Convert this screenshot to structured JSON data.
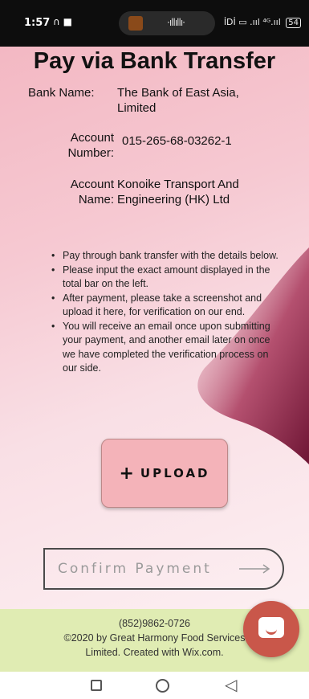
{
  "status_bar": {
    "time": "1:57",
    "left_icons": "∩ ■",
    "right_icons": "İDİ ▭ .ııl ⁴ᴳ.ııl",
    "battery": "54"
  },
  "page": {
    "title": "Pay via Bank Transfer",
    "bank_name_label": "Bank Name:",
    "bank_name_value": [
      "The Bank of East Asia,",
      "Limited"
    ],
    "account_number_label": [
      "Account",
      "Number:"
    ],
    "account_number_value": "015-265-68-03262-1",
    "account_name_label": [
      "Account",
      "Name:"
    ],
    "account_name_value": [
      "Konoike Transport And",
      "Engineering (HK) Ltd"
    ],
    "instructions": [
      "Pay through bank transfer with the details below.",
      "Please input the exact amount displayed in the total bar on the left.",
      "After payment, please take a screenshot and upload it here, for verification on our end.",
      "You will receive an email once upon submitting your payment, and another email later on once we have completed the verification process on our side."
    ],
    "upload_label": "UPLOAD",
    "upload_icon": "plus-icon",
    "confirm_label": "Confirm Payment",
    "confirm_icon": "arrow-right-icon"
  },
  "footer": {
    "phone": "(852)9862-0726",
    "copyright_line1": "©2020 by Great Harmony Food Services",
    "copyright_line2": "Limited. Created with Wix.com."
  },
  "colors": {
    "background_pink": "#f3b8c3",
    "upload_button": "#f4b3b9",
    "footer_green": "#e0ecb3",
    "chat_button": "#c9574a",
    "accent_maroon": "#7a1f3e"
  }
}
